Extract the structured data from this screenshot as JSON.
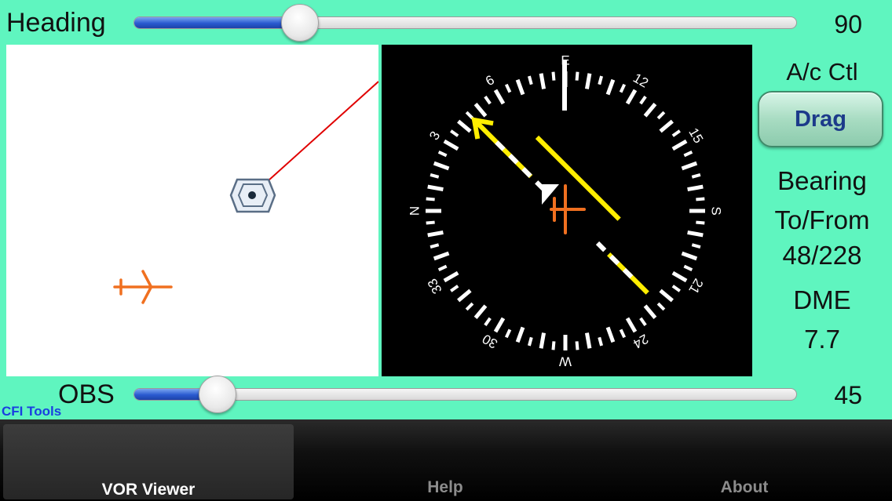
{
  "heading": {
    "label": "Heading",
    "value": "90",
    "fraction": 0.25
  },
  "obs": {
    "label": "OBS",
    "value": "45",
    "fraction": 0.125
  },
  "side_panel": {
    "control_title": "A/c Ctl",
    "drag_label": "Drag",
    "bearing_label_1": "Bearing",
    "bearing_label_2": "To/From",
    "bearing_value": "48/228",
    "dme_label": "DME",
    "dme_value": "7.7"
  },
  "brand": "CFI Tools",
  "tabs": [
    {
      "label": "VOR Viewer",
      "selected": true
    },
    {
      "label": "Help",
      "selected": false
    },
    {
      "label": "About",
      "selected": false
    }
  ],
  "hsi": {
    "cardinal_labels": [
      "E",
      "S",
      "W",
      "N"
    ],
    "number_labels": [
      "12",
      "15",
      "21",
      "24",
      "30",
      "33",
      "3",
      "6"
    ],
    "heading_deg": 90,
    "course_deg": 45
  },
  "colors": {
    "background": "#5ff5bf",
    "course_needle": "#ffee00",
    "aircraft": "#f07020",
    "radial_line": "#e00000"
  }
}
